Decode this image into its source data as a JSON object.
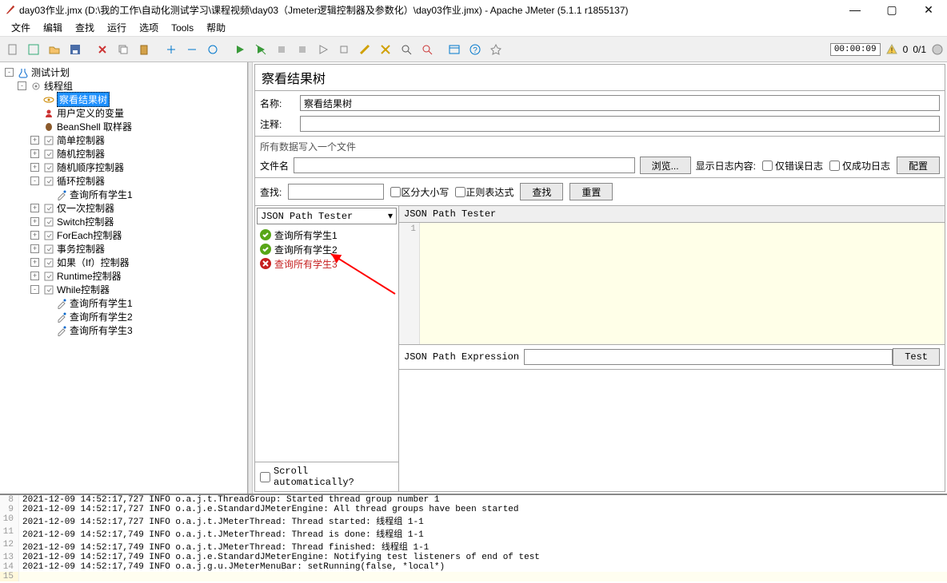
{
  "window_title": "day03作业.jmx (D:\\我的工作\\自动化测试学习\\课程视频\\day03（Jmeter逻辑控制器及参数化）\\day03作业.jmx) - Apache JMeter (5.1.1 r1855137)",
  "menu": [
    "文件",
    "编辑",
    "查找",
    "运行",
    "选项",
    "Tools",
    "帮助"
  ],
  "timer": "00:00:09",
  "threads_stat": "0/1",
  "warn_count": "0",
  "tree": [
    {
      "indent": 0,
      "toggle": "-",
      "icon": "beaker",
      "label": "测试计划"
    },
    {
      "indent": 1,
      "toggle": "-",
      "icon": "gears",
      "label": "线程组"
    },
    {
      "indent": 2,
      "toggle": "",
      "icon": "eye",
      "label": "察看结果树",
      "selected": true
    },
    {
      "indent": 2,
      "toggle": "",
      "icon": "user",
      "label": "用户定义的变量"
    },
    {
      "indent": 2,
      "toggle": "",
      "icon": "bean",
      "label": "BeanShell 取样器"
    },
    {
      "indent": 2,
      "toggle": "+",
      "icon": "ctrl",
      "label": "简单控制器"
    },
    {
      "indent": 2,
      "toggle": "+",
      "icon": "ctrl",
      "label": "随机控制器"
    },
    {
      "indent": 2,
      "toggle": "+",
      "icon": "ctrl",
      "label": "随机顺序控制器"
    },
    {
      "indent": 2,
      "toggle": "-",
      "icon": "ctrl",
      "label": "循环控制器"
    },
    {
      "indent": 3,
      "toggle": "",
      "icon": "pipette",
      "label": "查询所有学生1"
    },
    {
      "indent": 2,
      "toggle": "+",
      "icon": "ctrl",
      "label": "仅一次控制器"
    },
    {
      "indent": 2,
      "toggle": "+",
      "icon": "ctrl",
      "label": "Switch控制器"
    },
    {
      "indent": 2,
      "toggle": "+",
      "icon": "ctrl",
      "label": "ForEach控制器"
    },
    {
      "indent": 2,
      "toggle": "+",
      "icon": "ctrl",
      "label": "事务控制器"
    },
    {
      "indent": 2,
      "toggle": "+",
      "icon": "ctrl",
      "label": "如果（If）控制器"
    },
    {
      "indent": 2,
      "toggle": "+",
      "icon": "ctrl",
      "label": "Runtime控制器"
    },
    {
      "indent": 2,
      "toggle": "-",
      "icon": "ctrl",
      "label": "While控制器"
    },
    {
      "indent": 3,
      "toggle": "",
      "icon": "pipette",
      "label": "查询所有学生1"
    },
    {
      "indent": 3,
      "toggle": "",
      "icon": "pipette",
      "label": "查询所有学生2"
    },
    {
      "indent": 3,
      "toggle": "",
      "icon": "pipette",
      "label": "查询所有学生3"
    }
  ],
  "panel": {
    "title": "察看结果树",
    "name_label": "名称:",
    "name_value": "察看结果树",
    "comment_label": "注释:",
    "file_legend": "所有数据写入一个文件",
    "filename_label": "文件名",
    "browse_btn": "浏览...",
    "show_log_label": "显示日志内容:",
    "err_only": "仅错误日志",
    "succ_only": "仅成功日志",
    "config_btn": "配置",
    "search_label": "查找:",
    "case_label": "区分大小写",
    "regex_label": "正则表达式",
    "search_btn": "查找",
    "reset_btn": "重置",
    "tester_dropdown": "JSON Path Tester",
    "json_panel_label": "JSON Path Tester",
    "gutter1": "1",
    "expr_label": "JSON Path Expression",
    "test_btn": "Test",
    "auto_scroll": "Scroll automatically?",
    "results": [
      {
        "label": "查询所有学生1",
        "status": "pass"
      },
      {
        "label": "查询所有学生2",
        "status": "pass"
      },
      {
        "label": "查询所有学生3",
        "status": "fail"
      }
    ]
  },
  "console": [
    {
      "n": "8",
      "t": "2021-12-09 14:52:17,727 INFO o.a.j.t.ThreadGroup: Started thread group number 1"
    },
    {
      "n": "9",
      "t": "2021-12-09 14:52:17,727 INFO o.a.j.e.StandardJMeterEngine: All thread groups have been started"
    },
    {
      "n": "10",
      "t": "2021-12-09 14:52:17,727 INFO o.a.j.t.JMeterThread: Thread started: 线程组 1-1"
    },
    {
      "n": "11",
      "t": "2021-12-09 14:52:17,749 INFO o.a.j.t.JMeterThread: Thread is done: 线程组 1-1"
    },
    {
      "n": "12",
      "t": "2021-12-09 14:52:17,749 INFO o.a.j.t.JMeterThread: Thread finished: 线程组 1-1"
    },
    {
      "n": "13",
      "t": "2021-12-09 14:52:17,749 INFO o.a.j.e.StandardJMeterEngine: Notifying test listeners of end of test"
    },
    {
      "n": "14",
      "t": "2021-12-09 14:52:17,749 INFO o.a.j.g.u.JMeterMenuBar: setRunning(false, *local*)"
    },
    {
      "n": "15",
      "t": "",
      "cur": true
    }
  ]
}
